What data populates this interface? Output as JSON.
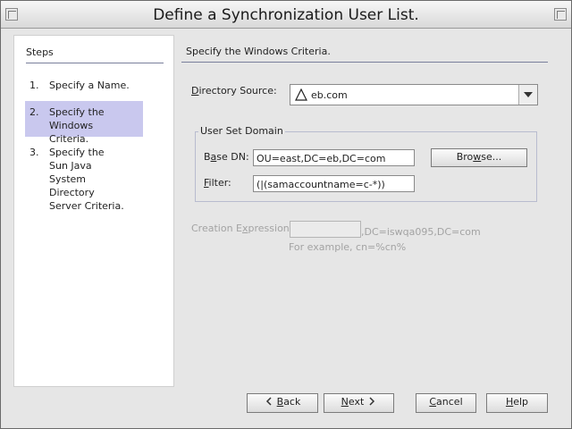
{
  "window": {
    "title": "Define a Synchronization User List."
  },
  "steps": {
    "header": "Steps",
    "items": [
      {
        "num": "1.",
        "label": "Specify a Name."
      },
      {
        "num": "2.",
        "label": "Specify the Windows Criteria."
      },
      {
        "num": "3.",
        "label": "Specify the Sun Java System Directory Server Criteria."
      }
    ]
  },
  "main": {
    "section_title": "Specify the Windows Criteria.",
    "directory_source": {
      "label_pre": "",
      "label_mn": "D",
      "label_post": "irectory Source:",
      "value": "eb.com",
      "icon": "warning-icon"
    },
    "user_set_domain": {
      "legend": "User Set Domain",
      "base_dn": {
        "label_pre": "B",
        "label_mn": "a",
        "label_post": "se DN:",
        "value": "OU=east,DC=eb,DC=com"
      },
      "filter": {
        "label_pre": "",
        "label_mn": "F",
        "label_post": "ilter:",
        "value": "(|(samaccountname=c-*))"
      },
      "browse": {
        "pre": "Bro",
        "mn": "w",
        "post": "se..."
      }
    },
    "creation_expression": {
      "label_pre": "Creation E",
      "label_mn": "x",
      "label_post": "pression:",
      "value": "",
      "suffix": ",DC=iswqa095,DC=com",
      "example": "For example, cn=%cn%"
    }
  },
  "footer": {
    "back": {
      "mn": "B",
      "post": "ack"
    },
    "next": {
      "mn": "N",
      "post": "ext"
    },
    "cancel": {
      "mn": "C",
      "post": "ancel"
    },
    "help": {
      "mn": "H",
      "post": "elp"
    }
  }
}
